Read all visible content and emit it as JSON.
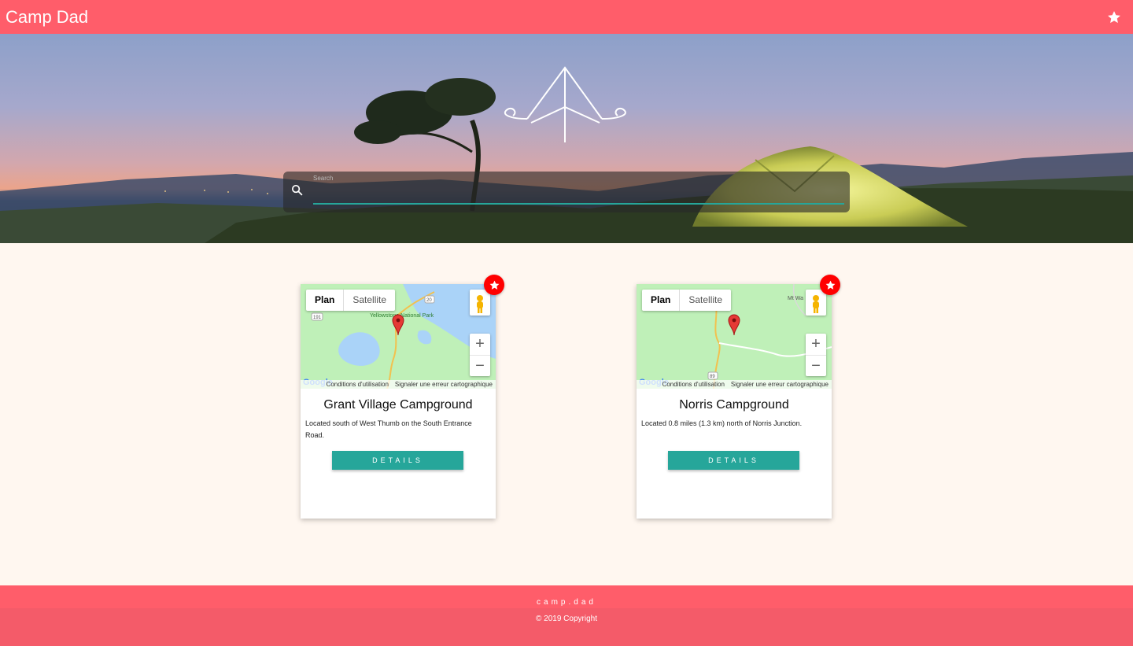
{
  "appbar": {
    "title": "Camp Dad",
    "favorites_icon": "star-icon"
  },
  "search": {
    "label": "Search",
    "value": "",
    "icon": "search-icon"
  },
  "map_controls": {
    "plan": "Plan",
    "satellite": "Satellite",
    "zoom_in": "+",
    "zoom_out": "−",
    "terms": "Conditions d'utilisation",
    "report": "Signaler une erreur cartographique",
    "logo": "Google"
  },
  "campgrounds": [
    {
      "name": "Grant Village Campground",
      "description": "Located south of West Thumb on the South Entrance Road.",
      "details_label": "DETAILS",
      "map_labels": [
        "Yellowstone National Park",
        "20",
        "191"
      ]
    },
    {
      "name": "Norris Campground",
      "description": "Located 0.8 miles (1.3 km) north of Norris Junction.",
      "details_label": "DETAILS",
      "map_labels": [
        "Mt Wa",
        "89"
      ]
    }
  ],
  "footer": {
    "brand": "camp.dad",
    "copyright": "© 2019 Copyright"
  },
  "colors": {
    "primary": "#ff5d6a",
    "accent": "#26a69a",
    "fav": "#ff0000",
    "background": "#fff7f0"
  }
}
